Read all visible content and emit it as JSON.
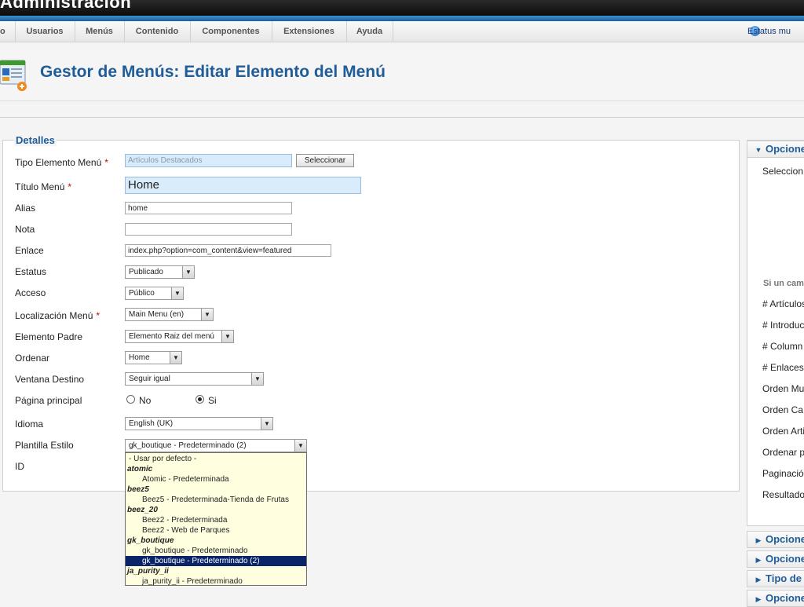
{
  "header": {
    "brand": "Administración"
  },
  "menubar": {
    "items": [
      "o",
      "Usuarios",
      "Menús",
      "Contenido",
      "Componentes",
      "Extensiones",
      "Ayuda"
    ],
    "status": "Estatus mu"
  },
  "page": {
    "title": "Gestor de Menús: Editar Elemento del Menú"
  },
  "details": {
    "legend": "Detalles",
    "tipo": {
      "label": "Tipo Elemento Menú",
      "value": "Artículos Destacados",
      "button": "Seleccionar"
    },
    "titulo": {
      "label": "Título Menú",
      "value": "Home"
    },
    "alias": {
      "label": "Alias",
      "value": "home"
    },
    "nota": {
      "label": "Nota",
      "value": ""
    },
    "enlace": {
      "label": "Enlace",
      "value": "index.php?option=com_content&view=featured"
    },
    "estatus": {
      "label": "Estatus",
      "value": "Publicado"
    },
    "acceso": {
      "label": "Acceso",
      "value": "Público"
    },
    "localizacion": {
      "label": "Localización Menú",
      "value": "Main Menu (en)"
    },
    "padre": {
      "label": "Elemento Padre",
      "value": "Elemento Raiz del menú"
    },
    "ordenar": {
      "label": "Ordenar",
      "value": "Home"
    },
    "ventana": {
      "label": "Ventana Destino",
      "value": "Seguir igual"
    },
    "principal": {
      "label": "Página principal",
      "no": "No",
      "si": "Si",
      "selected": "Si"
    },
    "idioma": {
      "label": "Idioma",
      "value": "English (UK)"
    },
    "plantilla": {
      "label": "Plantilla Estilo",
      "value": "gk_boutique - Predeterminado (2)"
    },
    "id": {
      "label": "ID"
    }
  },
  "dropdown": {
    "options": [
      {
        "text": "- Usar por defecto -",
        "kind": "first"
      },
      {
        "text": "atomic",
        "kind": "grp"
      },
      {
        "text": "Atomic - Predeterminada",
        "kind": "opt"
      },
      {
        "text": "beez5",
        "kind": "grp"
      },
      {
        "text": "Beez5 - Predeterminada-Tienda de Frutas",
        "kind": "opt"
      },
      {
        "text": "beez_20",
        "kind": "grp"
      },
      {
        "text": "Beez2 - Predeterminada",
        "kind": "opt"
      },
      {
        "text": "Beez2 - Web de Parques",
        "kind": "opt"
      },
      {
        "text": "gk_boutique",
        "kind": "grp"
      },
      {
        "text": "gk_boutique - Predeterminado",
        "kind": "opt"
      },
      {
        "text": "gk_boutique - Predeterminado (2)",
        "kind": "opt",
        "selected": true
      },
      {
        "text": "ja_purity_ii",
        "kind": "grp"
      },
      {
        "text": "ja_purity_ii - Predeterminado",
        "kind": "opt"
      }
    ]
  },
  "rightpanel": {
    "open_header": "Opcione",
    "items": [
      "Seleccion",
      "Si un cam",
      "# Artículos",
      "# Introduc",
      "# Column",
      "# Enlaces",
      "Orden Mu",
      "Orden Ca",
      "Orden Arti",
      "Ordenar p",
      "Paginació",
      "Resultado"
    ],
    "closed_headers": [
      "Opcione",
      "Opcione",
      "Tipo de",
      "Opcione"
    ]
  }
}
